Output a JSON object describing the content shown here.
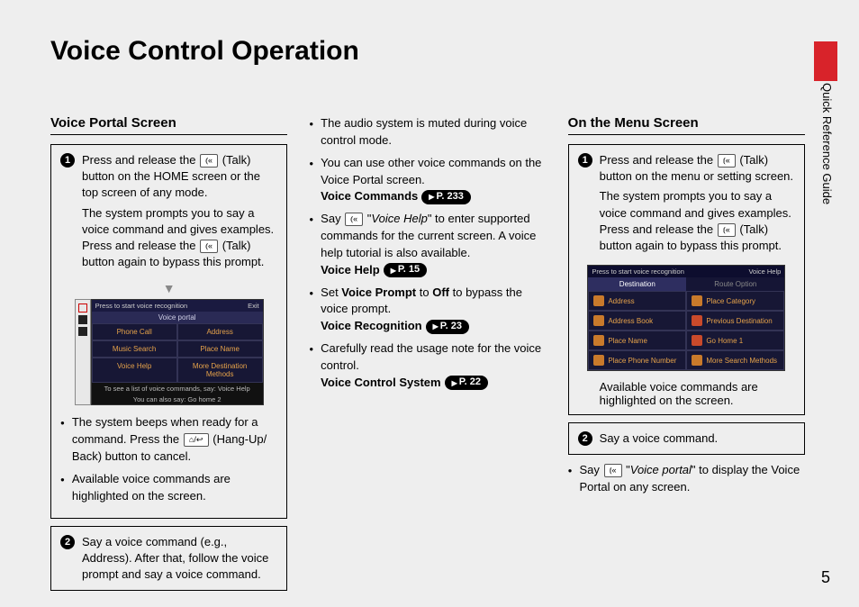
{
  "page": {
    "title": "Voice Control Operation",
    "side_label": "Quick Reference Guide",
    "number": "5"
  },
  "col1": {
    "heading": "Voice Portal Screen",
    "step1": {
      "num": "1",
      "p1_a": "Press and release the ",
      "p1_b": " (Talk) button on the HOME screen or the top screen of any mode.",
      "p2_a": "The system prompts you to say a voice command and gives examples. Press and release the ",
      "p2_b": " (Talk) button again to bypass this prompt."
    },
    "vp": {
      "top_left": "Press          to start voice recognition",
      "top_right": "Exit",
      "sub": "Voice portal",
      "cells": [
        "Phone Call",
        "Address",
        "Music Search",
        "Place Name",
        "Voice Help",
        "More Destination Methods"
      ],
      "foot1": "To see a list of voice commands, say: Voice Help",
      "foot2": "You can also say: Go home 2"
    },
    "b1_a": "The system beeps when ready for a command. Press the ",
    "b1_b": " (Hang-Up/ Back) button to cancel.",
    "b2": "Available voice commands are highlighted on the screen.",
    "step2": {
      "num": "2",
      "text": "Say a voice command (e.g., Address). After that, follow the voice prompt and say a voice command."
    }
  },
  "col2": {
    "b1": "The audio system is muted during voice control mode.",
    "b2": "You can use other voice commands on the Voice Portal screen.",
    "b2_bold": "Voice Commands",
    "b2_ref": "P. 233",
    "b3_a": "Say ",
    "b3_q": "Voice Help",
    "b3_b": " to enter supported commands for the current screen. A voice help tutorial is also available.",
    "b3_bold": "Voice Help",
    "b3_ref": "P. 15",
    "b4_a": "Set ",
    "b4_vp": "Voice Prompt",
    "b4_to": " to ",
    "b4_off": "Off",
    "b4_b": " to bypass the voice prompt.",
    "b4_bold": "Voice Recognition",
    "b4_ref": "P. 23",
    "b5": "Carefully read the usage note for the voice control.",
    "b5_bold": "Voice Control System",
    "b5_ref": "P. 22"
  },
  "col3": {
    "heading": "On the Menu Screen",
    "step1": {
      "num": "1",
      "p1_a": "Press and release the ",
      "p1_b": " (Talk) button on the menu or setting screen.",
      "p2_a": "The system prompts you to say a voice command and gives examples. Press and release the ",
      "p2_b": " (Talk) button again to bypass this prompt."
    },
    "menu": {
      "top_left": "Press        to start voice recognition",
      "top_right": "Voice Help",
      "tabs": [
        "Destination",
        "Route Option"
      ],
      "cells": [
        "Address",
        "Place Category",
        "Address Book",
        "Previous Destination",
        "Place Name",
        "Go Home 1",
        "Place Phone Number",
        "More Search Methods"
      ]
    },
    "step1_note": "Available voice commands are highlighted on the screen.",
    "step2": {
      "num": "2",
      "text": "Say a voice command."
    },
    "b1_a": "Say ",
    "b1_q": "Voice portal",
    "b1_b": " to display the Voice Portal on any screen."
  }
}
